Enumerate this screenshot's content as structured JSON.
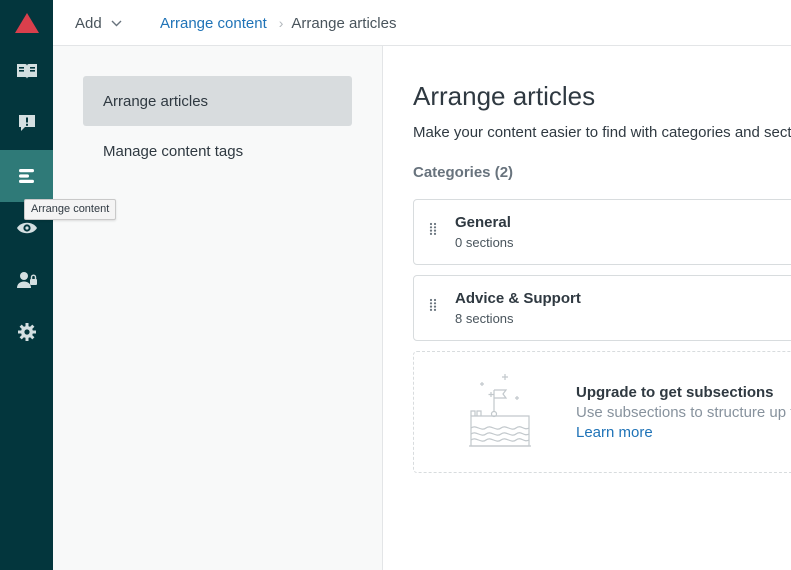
{
  "rail": {
    "tooltip": "Arrange content",
    "items": [
      {
        "icon": "book-icon"
      },
      {
        "icon": "alert-icon"
      },
      {
        "icon": "arrange-content-icon",
        "active": true
      },
      {
        "icon": "eye-icon"
      },
      {
        "icon": "user-lock-icon"
      },
      {
        "icon": "gear-icon"
      }
    ],
    "colors": {
      "background": "#03363d",
      "active": "#2f7a78",
      "logo": "#d93f4c"
    }
  },
  "topbar": {
    "add_label": "Add",
    "breadcrumb": {
      "link": "Arrange content",
      "separator": "›",
      "current": "Arrange articles"
    }
  },
  "sidenav": {
    "items": [
      {
        "label": "Arrange articles",
        "selected": true
      },
      {
        "label": "Manage content tags",
        "selected": false
      }
    ]
  },
  "main": {
    "title": "Arrange articles",
    "description": "Make your content easier to find with categories and sections",
    "categories_heading": "Categories (2)",
    "categories": [
      {
        "name": "General",
        "sections": "0 sections"
      },
      {
        "name": "Advice & Support",
        "sections": "8 sections"
      }
    ],
    "upgrade": {
      "title": "Upgrade to get subsections",
      "description": "Use subsections to structure up to",
      "link": "Learn more"
    }
  }
}
